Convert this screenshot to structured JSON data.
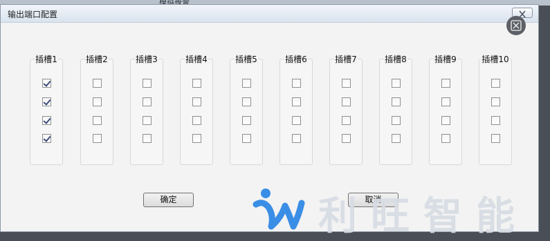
{
  "background": {
    "title_fragment": "模拟报警"
  },
  "dialog": {
    "title": "输出端口配置",
    "close_label": "",
    "ok_label": "确定",
    "cancel_label": "取消"
  },
  "slots": [
    {
      "label": "插槽1",
      "checks": [
        true,
        true,
        true,
        true
      ]
    },
    {
      "label": "插槽2",
      "checks": [
        false,
        false,
        false,
        false
      ]
    },
    {
      "label": "插槽3",
      "checks": [
        false,
        false,
        false,
        false
      ]
    },
    {
      "label": "插槽4",
      "checks": [
        false,
        false,
        false,
        false
      ]
    },
    {
      "label": "插槽5",
      "checks": [
        false,
        false,
        false,
        false
      ]
    },
    {
      "label": "插槽6",
      "checks": [
        false,
        false,
        false,
        false
      ]
    },
    {
      "label": "插槽7",
      "checks": [
        false,
        false,
        false,
        false
      ]
    },
    {
      "label": "插槽8",
      "checks": [
        false,
        false,
        false,
        false
      ]
    },
    {
      "label": "插槽9",
      "checks": [
        false,
        false,
        false,
        false
      ]
    },
    {
      "label": "插槽10",
      "checks": [
        false,
        false,
        false,
        false
      ]
    }
  ],
  "watermark": {
    "text": "利旺智能",
    "icon": "brand-logo-icon"
  },
  "colors": {
    "accent": "#3a8ee6",
    "check": "#3b4a7a"
  }
}
